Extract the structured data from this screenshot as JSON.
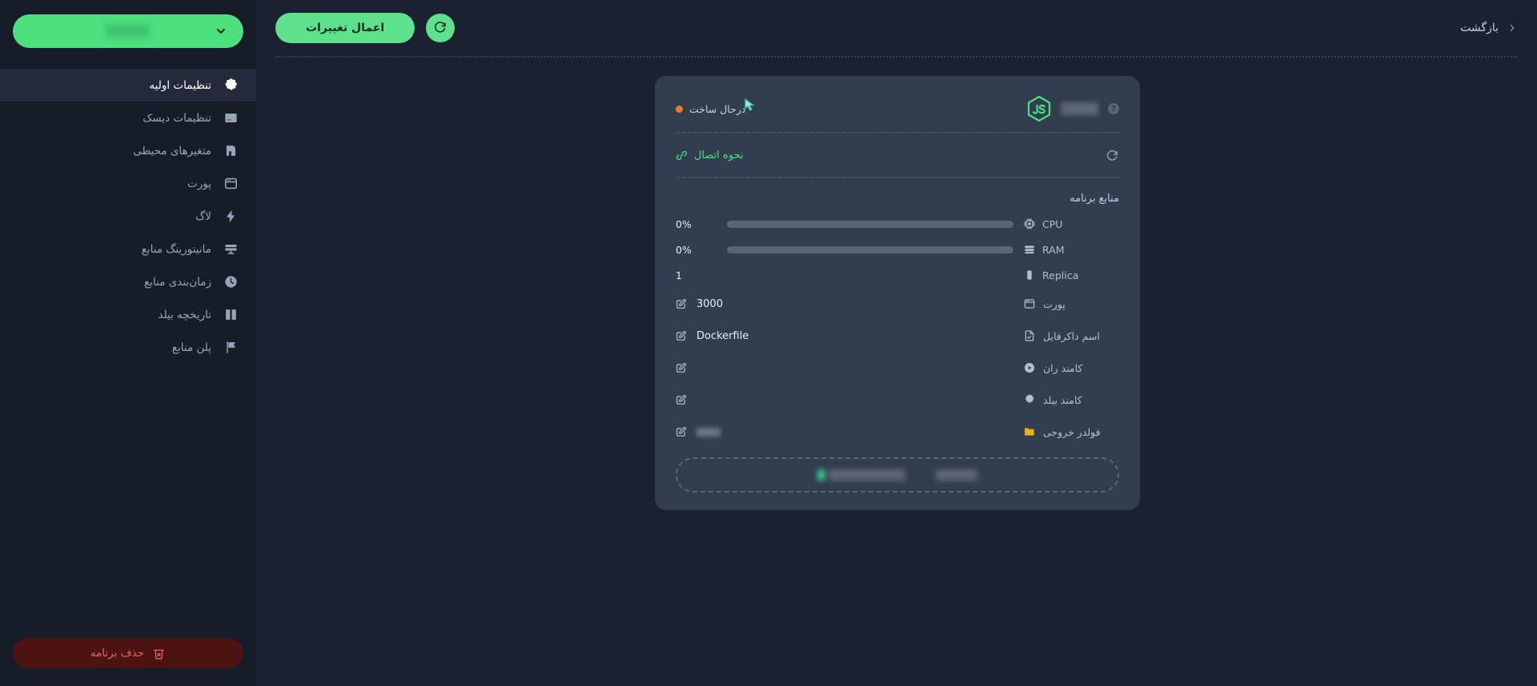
{
  "topbar": {
    "back_label": "بازگشت",
    "apply_label": "اعمال تغییرات",
    "refresh_icon": "refresh-icon",
    "chevron_icon": "chevron-left-icon"
  },
  "sidebar": {
    "app_switcher": {
      "app_name": "▒▒▒▒▒",
      "chevron_icon": "chevron-down-icon",
      "accent": "#4ce07f"
    },
    "items": [
      {
        "label": "تنظیمات اولیه",
        "icon": "gear-icon",
        "active": true
      },
      {
        "label": "تنظیمات دیسک",
        "icon": "hard-drive-icon",
        "active": false
      },
      {
        "label": "متغیرهای محیطی",
        "icon": "variables-icon",
        "active": false
      },
      {
        "label": "پورت",
        "icon": "port-window-icon",
        "active": false
      },
      {
        "label": "لاگ",
        "icon": "bolt-icon",
        "active": false
      },
      {
        "label": "مانیتورینگ منابع",
        "icon": "monitor-icon",
        "active": false
      },
      {
        "label": "زمان‌بندی منابع",
        "icon": "clock-icon",
        "active": false
      },
      {
        "label": "تاریخچه بیلد",
        "icon": "book-icon",
        "active": false
      },
      {
        "label": "پلن منابع",
        "icon": "flag-icon",
        "active": false
      }
    ],
    "delete_button": {
      "label": "حذف برنامه",
      "icon": "trash-x-icon",
      "color": "#e8645e"
    }
  },
  "card": {
    "header": {
      "platform_icon": "nodejs-js-icon",
      "platform_name": "▒▒▒▒",
      "help_icon": "question-mark-icon",
      "status_text": "درحال ساخت",
      "status_color": "#f07a1e"
    },
    "connection": {
      "label": "نحوه اتصال",
      "link_icon": "link-icon",
      "refresh_icon": "refresh-icon",
      "color": "#4ce07f"
    },
    "resources_title": "منابع برنامه",
    "resources": [
      {
        "label": "CPU",
        "icon": "cpu-icon",
        "value": "0%",
        "percent": 0,
        "bar": true
      },
      {
        "label": "RAM",
        "icon": "ram-icon",
        "value": "0%",
        "percent": 0,
        "bar": true
      },
      {
        "label": "Replica",
        "icon": "replica-icon",
        "value": "1",
        "percent": 0,
        "bar": false
      }
    ],
    "config": [
      {
        "label": "پورت",
        "icon": "port-window-icon",
        "value": "3000",
        "redacted": false,
        "edit_icon": "edit-icon"
      },
      {
        "label": "اسم داکرفایل",
        "icon": "file-check-icon",
        "value": "Dockerfile",
        "redacted": false,
        "edit_icon": "edit-icon"
      },
      {
        "label": "کامند ران",
        "icon": "play-icon",
        "value": "",
        "redacted": false,
        "edit_icon": "edit-icon"
      },
      {
        "label": "کامند بیلد",
        "icon": "gear-icon",
        "value": "",
        "redacted": false,
        "edit_icon": "edit-icon"
      },
      {
        "label": "فولدر خروجی",
        "icon": "folder-icon",
        "value": "▒▒▒",
        "redacted": true,
        "edit_icon": "edit-icon"
      }
    ],
    "dropzone": {
      "chip_green": "",
      "chip_a": "",
      "chip_b": ""
    }
  }
}
